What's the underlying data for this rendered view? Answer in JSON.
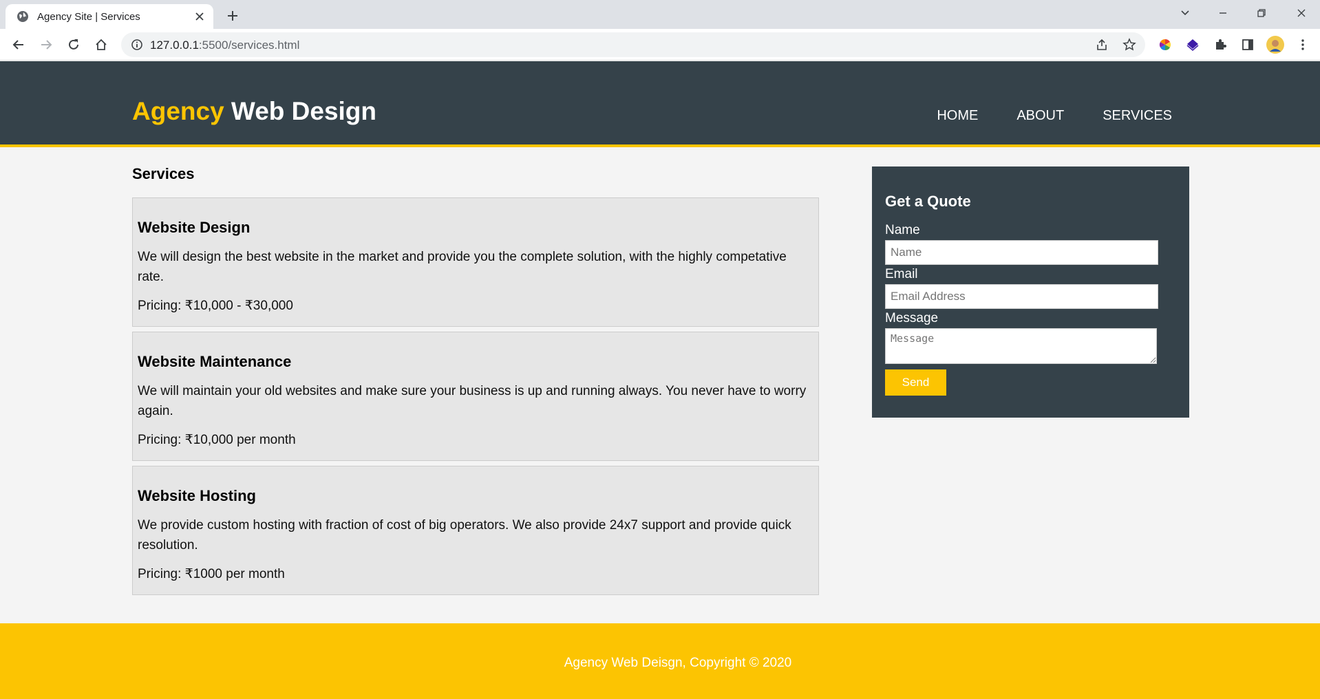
{
  "browser": {
    "tab_title": "Agency Site | Services",
    "url_host": "127.0.0.1",
    "url_path": ":5500/services.html"
  },
  "header": {
    "brand_highlight": "Agency",
    "brand_rest": " Web Design",
    "nav": [
      {
        "label": "Home"
      },
      {
        "label": "About"
      },
      {
        "label": "Services"
      }
    ]
  },
  "main": {
    "title": "Services",
    "services": [
      {
        "title": "Website Design",
        "description": "We will design the best website in the market and provide you the complete solution, with the highly competative rate.",
        "pricing": "Pricing: ₹10,000 - ₹30,000"
      },
      {
        "title": "Website Maintenance",
        "description": "We will maintain your old websites and make sure your business is up and running always. You never have to worry again.",
        "pricing": "Pricing: ₹10,000 per month"
      },
      {
        "title": "Website Hosting",
        "description": "We provide custom hosting with fraction of cost of big operators. We also provide 24x7 support and provide quick resolution.",
        "pricing": "Pricing: ₹1000 per month"
      }
    ]
  },
  "quote": {
    "title": "Get a Quote",
    "name_label": "Name",
    "name_placeholder": "Name",
    "email_label": "Email",
    "email_placeholder": "Email Address",
    "message_label": "Message",
    "message_placeholder": "Message",
    "send_label": "Send"
  },
  "footer": {
    "text": "Agency Web Deisgn, Copyright © 2020"
  },
  "colors": {
    "header_bg": "#35424a",
    "accent": "#fcc402",
    "service_bg": "#e6e6e6"
  }
}
